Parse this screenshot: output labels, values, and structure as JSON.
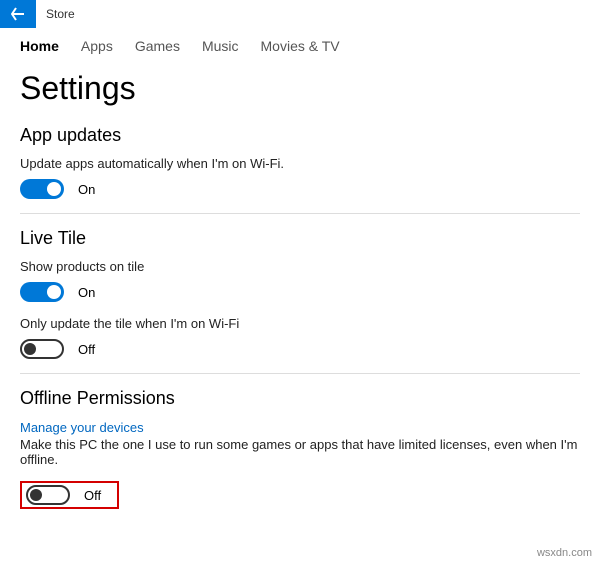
{
  "titlebar": {
    "app_name": "Store"
  },
  "tabs": [
    {
      "label": "Home",
      "active": true
    },
    {
      "label": "Apps",
      "active": false
    },
    {
      "label": "Games",
      "active": false
    },
    {
      "label": "Music",
      "active": false
    },
    {
      "label": "Movies & TV",
      "active": false
    }
  ],
  "page_title": "Settings",
  "sections": {
    "app_updates": {
      "title": "App updates",
      "auto_update": {
        "desc": "Update apps automatically when I'm on Wi-Fi.",
        "state": "On",
        "on": true
      }
    },
    "live_tile": {
      "title": "Live Tile",
      "show_products": {
        "desc": "Show products on tile",
        "state": "On",
        "on": true
      },
      "update_wifi": {
        "desc": "Only update the tile when I'm on Wi-Fi",
        "state": "Off",
        "on": false
      }
    },
    "offline": {
      "title": "Offline Permissions",
      "manage_link": "Manage your devices",
      "desc": "Make this PC the one I use to run some games or apps that have limited licenses, even when I'm offline.",
      "toggle": {
        "state": "Off",
        "on": false
      }
    }
  },
  "watermark": "wsxdn.com"
}
